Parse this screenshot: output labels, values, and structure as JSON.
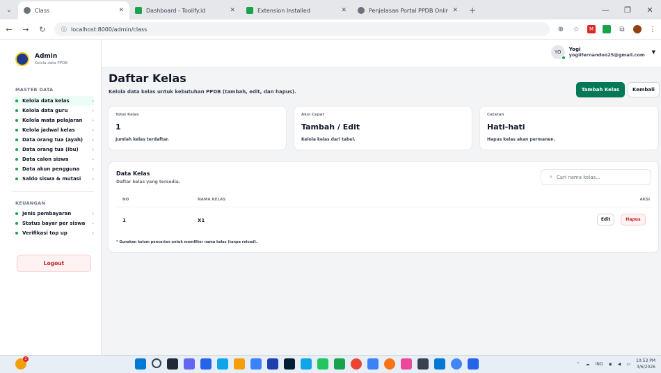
{
  "browser": {
    "tabs": [
      {
        "title": "Class",
        "active": true
      },
      {
        "title": "Dashboard - Toolify.id",
        "active": false
      },
      {
        "title": "Extension Installed",
        "active": false
      },
      {
        "title": "Penjelasan Portal PPDB Online",
        "active": false
      }
    ],
    "url": "localhost:8000/admin/class"
  },
  "sidebar": {
    "brand_title": "Admin",
    "brand_sub": "Kelola data PPDB",
    "sections": [
      {
        "title": "MASTER DATA",
        "items": [
          {
            "label": "Kelola data kelas",
            "active": true
          },
          {
            "label": "Kelola data guru"
          },
          {
            "label": "Kelola mata pelajaran"
          },
          {
            "label": "Kelola jadwal kelas"
          },
          {
            "label": "Data orang tua (ayah)"
          },
          {
            "label": "Data orang tua (ibu)"
          },
          {
            "label": "Data calon siswa"
          },
          {
            "label": "Data akun pengguna"
          },
          {
            "label": "Saldo siswa & mutasi"
          }
        ]
      },
      {
        "title": "KEUANGAN",
        "items": [
          {
            "label": "Jenis pembayaran"
          },
          {
            "label": "Status bayar per siswa"
          },
          {
            "label": "Verifikasi top up"
          }
        ]
      }
    ],
    "logout_label": "Logout"
  },
  "user": {
    "initials": "YO",
    "name": "Yogi",
    "email": "yogiifernandoo25@gmail.com"
  },
  "page": {
    "title": "Daftar Kelas",
    "subtitle": "Kelola data kelas untuk kebutuhan PPDB (tambah, edit, dan hapus).",
    "add_button": "Tambah Kelas",
    "back_button": "Kembali"
  },
  "cards": [
    {
      "label": "Total Kelas",
      "value": "1",
      "note": "Jumlah kelas terdaftar."
    },
    {
      "label": "Aksi Cepat",
      "value": "Tambah / Edit",
      "note": "Kelola kelas dari tabel."
    },
    {
      "label": "Catatan",
      "value": "Hati-hati",
      "note": "Hapus kelas akan permanen."
    }
  ],
  "table": {
    "title": "Data Kelas",
    "subtitle": "Daftar kelas yang tersedia.",
    "search_placeholder": "Cari nama kelas...",
    "headers": {
      "no": "NO",
      "name": "NAMA KELAS",
      "action": "AKSI"
    },
    "rows": [
      {
        "no": "1",
        "name": "X1",
        "edit": "Edit",
        "delete": "Hapus"
      }
    ],
    "hint": "* Gunakan kolom pencarian untuk memfilter nama kelas (tanpa reload)."
  },
  "taskbar": {
    "weather_badge": "2",
    "lang": "IND",
    "time": "10:53 PM",
    "date": "3/6/2026"
  }
}
